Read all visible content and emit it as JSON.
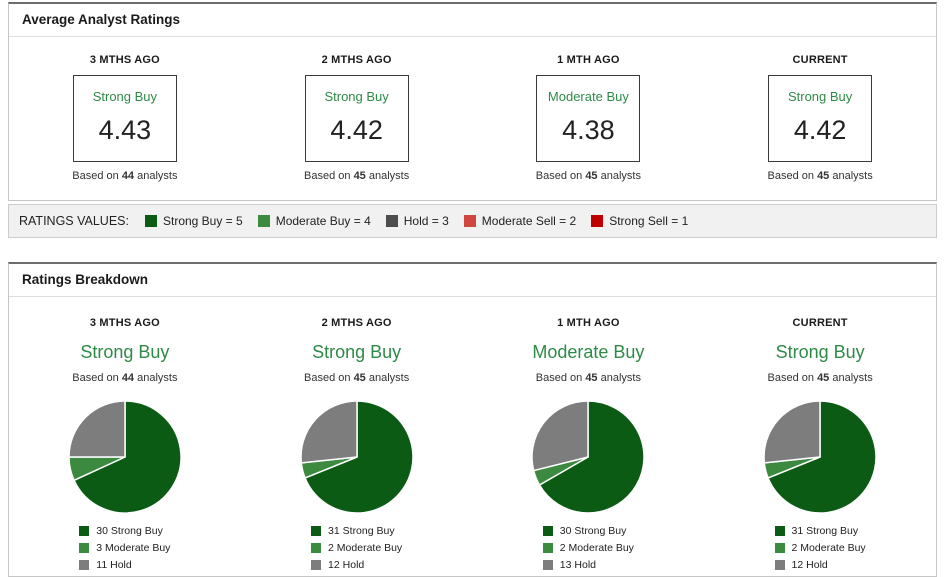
{
  "colors": {
    "strong_buy": "#0b5b14",
    "moderate_buy": "#3c8a40",
    "hold_pie": "#7d7d7d",
    "hold_strip": "#4d4d4d",
    "moderate_sell": "#d0473f",
    "strong_sell": "#c00000",
    "rating_text_green": "#2e8b47"
  },
  "avg_panel": {
    "title": "Average Analyst Ratings",
    "based_prefix": "Based on",
    "based_suffix": "analysts",
    "columns": [
      {
        "period": "3 MTHS AGO",
        "rating": "Strong Buy",
        "value": "4.43",
        "analysts": "44"
      },
      {
        "period": "2 MTHS AGO",
        "rating": "Strong Buy",
        "value": "4.42",
        "analysts": "45"
      },
      {
        "period": "1 MTH AGO",
        "rating": "Moderate Buy",
        "value": "4.38",
        "analysts": "45"
      },
      {
        "period": "CURRENT",
        "rating": "Strong Buy",
        "value": "4.42",
        "analysts": "45"
      }
    ]
  },
  "ratings_values": {
    "label": "RATINGS VALUES:",
    "items": [
      {
        "label": "Strong Buy = 5",
        "color": "#0b5b14"
      },
      {
        "label": "Moderate Buy = 4",
        "color": "#3c8a40"
      },
      {
        "label": "Hold = 3",
        "color": "#4d4d4d"
      },
      {
        "label": "Moderate Sell = 2",
        "color": "#d0473f"
      },
      {
        "label": "Strong Sell = 1",
        "color": "#c00000"
      }
    ]
  },
  "breakdown_panel": {
    "title": "Ratings Breakdown",
    "based_prefix": "Based on",
    "based_suffix": "analysts",
    "columns": [
      {
        "period": "3 MTHS AGO",
        "rating": "Strong Buy",
        "analysts": "44",
        "legend": [
          "30 Strong Buy",
          "3 Moderate Buy",
          "11 Hold"
        ]
      },
      {
        "period": "2 MTHS AGO",
        "rating": "Strong Buy",
        "analysts": "45",
        "legend": [
          "31 Strong Buy",
          "2 Moderate Buy",
          "12 Hold"
        ]
      },
      {
        "period": "1 MTH AGO",
        "rating": "Moderate Buy",
        "analysts": "45",
        "legend": [
          "30 Strong Buy",
          "2 Moderate Buy",
          "13 Hold"
        ]
      },
      {
        "period": "CURRENT",
        "rating": "Strong Buy",
        "analysts": "45",
        "legend": [
          "31 Strong Buy",
          "2 Moderate Buy",
          "12 Hold"
        ]
      }
    ]
  },
  "chart_data": [
    {
      "type": "pie",
      "title": "3 MTHS AGO",
      "labels": [
        "Strong Buy",
        "Moderate Buy",
        "Hold"
      ],
      "values": [
        30,
        3,
        11
      ],
      "colors": [
        "#0b5b14",
        "#3c8a40",
        "#7d7d7d"
      ],
      "start_angle_deg": 0,
      "direction": "clockwise",
      "legend_position": "bottom"
    },
    {
      "type": "pie",
      "title": "2 MTHS AGO",
      "labels": [
        "Strong Buy",
        "Moderate Buy",
        "Hold"
      ],
      "values": [
        31,
        2,
        12
      ],
      "colors": [
        "#0b5b14",
        "#3c8a40",
        "#7d7d7d"
      ],
      "start_angle_deg": 0,
      "direction": "clockwise",
      "legend_position": "bottom"
    },
    {
      "type": "pie",
      "title": "1 MTH AGO",
      "labels": [
        "Strong Buy",
        "Moderate Buy",
        "Hold"
      ],
      "values": [
        30,
        2,
        13
      ],
      "colors": [
        "#0b5b14",
        "#3c8a40",
        "#7d7d7d"
      ],
      "start_angle_deg": 0,
      "direction": "clockwise",
      "legend_position": "bottom"
    },
    {
      "type": "pie",
      "title": "CURRENT",
      "labels": [
        "Strong Buy",
        "Moderate Buy",
        "Hold"
      ],
      "values": [
        31,
        2,
        12
      ],
      "colors": [
        "#0b5b14",
        "#3c8a40",
        "#7d7d7d"
      ],
      "start_angle_deg": 0,
      "direction": "clockwise",
      "legend_position": "bottom"
    }
  ]
}
